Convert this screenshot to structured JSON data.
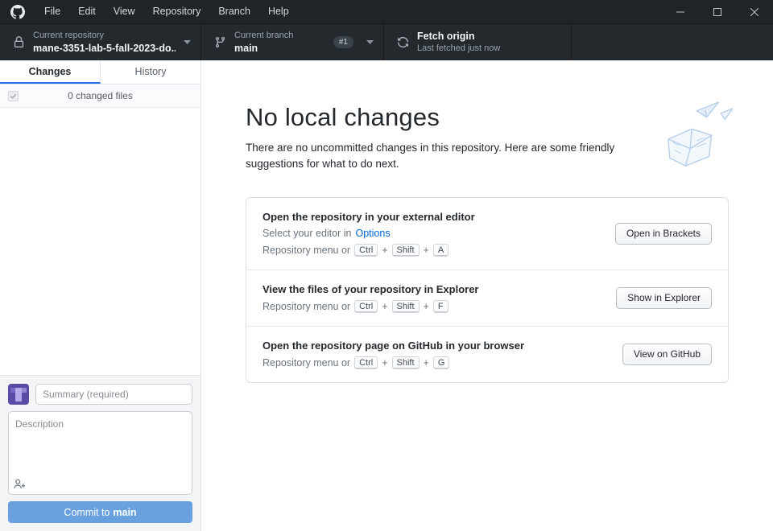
{
  "window": {
    "menu": [
      "File",
      "Edit",
      "View",
      "Repository",
      "Branch",
      "Help"
    ]
  },
  "toolbar": {
    "repository": {
      "label": "Current repository",
      "value": "mane-3351-lab-5-fall-2023-do..."
    },
    "branch": {
      "label": "Current branch",
      "value": "main",
      "badge": "#1"
    },
    "fetch": {
      "title": "Fetch origin",
      "subtitle": "Last fetched just now"
    }
  },
  "sidebar": {
    "tabs": [
      {
        "label": "Changes"
      },
      {
        "label": "History"
      }
    ],
    "changed_files_text": "0 changed files",
    "commit": {
      "summary_placeholder": "Summary (required)",
      "description_placeholder": "Description",
      "button_prefix": "Commit to",
      "button_branch": "main"
    }
  },
  "main": {
    "title": "No local changes",
    "subtitle": "There are no uncommitted changes in this repository. Here are some friendly suggestions for what to do next.",
    "suggestions": [
      {
        "title": "Open the repository in your external editor",
        "editor_prefix": "Select your editor in",
        "editor_link": "Options",
        "menu_text": "Repository menu or",
        "keys": [
          "Ctrl",
          "Shift",
          "A"
        ],
        "button": "Open in Brackets"
      },
      {
        "title": "View the files of your repository in Explorer",
        "menu_text": "Repository menu or",
        "keys": [
          "Ctrl",
          "Shift",
          "F"
        ],
        "button": "Show in Explorer"
      },
      {
        "title": "Open the repository page on GitHub in your browser",
        "menu_text": "Repository menu or",
        "keys": [
          "Ctrl",
          "Shift",
          "G"
        ],
        "button": "View on GitHub"
      }
    ]
  },
  "ui": {
    "plus": "+"
  },
  "colors": {
    "link": "#0366d6",
    "tab_underline": "#1f6feb",
    "commit_button": "#69a1df"
  }
}
